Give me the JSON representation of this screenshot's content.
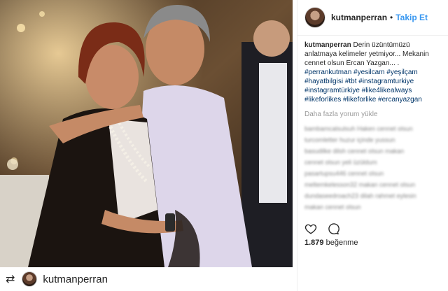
{
  "header": {
    "username": "kutmanperran",
    "separator": "•",
    "follow_label": "Takip Et"
  },
  "caption": {
    "username": "kutmanperran",
    "text": "Derin üzüntümüzü anlatmaya kelimeler yetmiyor... Mekanin cennet olsun Ercan Yazgan... .",
    "hashtags": "#perrankutman #yesilcam #yeşilçam #hayatbilgisi #tbt #instagramturkiye #instagramtürkiye #like4likealways #likeforlikes #likeforlike #ercanyazgan"
  },
  "load_more_label": "Daha fazla yorum yükle",
  "blurred_comments": [
    "bambamcalsulsuh Haken cennet olsun",
    "turcomletter huzur içinde yussun",
    "basudilke dilsh cennet olsun makan",
    "cennet olsun yeli üzüldum",
    "pasartupsu446 cennet olsun",
    "meltemkelesson32 makan cennet olsun",
    "dundaseedroach23 dilah rahmet eylesin",
    "makan cennet olsun"
  ],
  "actions": {
    "like_icon": "heart-icon",
    "comment_icon": "comment-icon"
  },
  "likes": {
    "count": "1.879",
    "label": "beğenme"
  },
  "repost": {
    "icon": "repost-icon",
    "username": "kutmanperran"
  },
  "colors": {
    "link": "#3897f0",
    "hashtag": "#003569",
    "text": "#262626"
  }
}
